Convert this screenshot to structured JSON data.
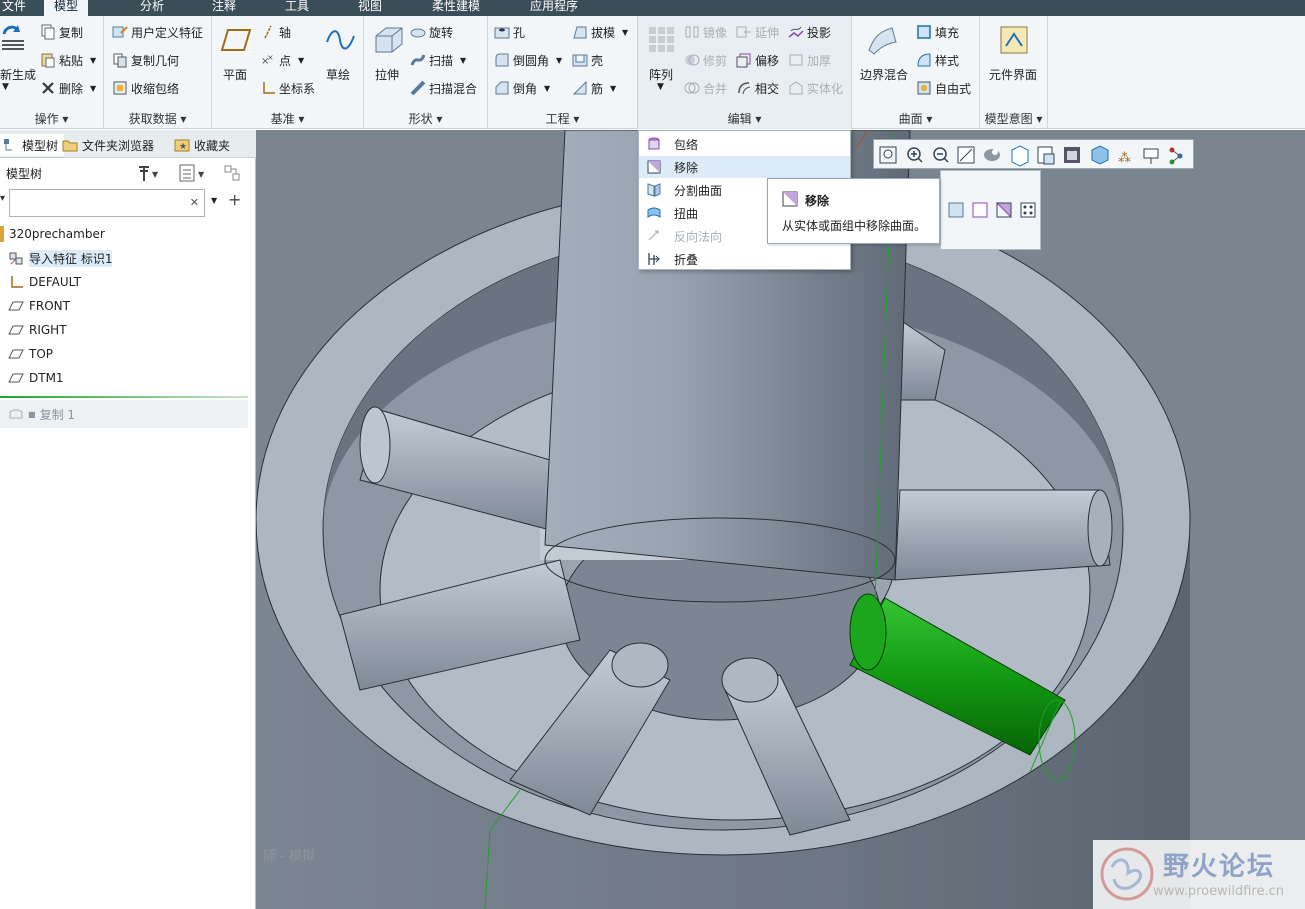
{
  "menu": {
    "tabs": [
      "文件",
      "模型",
      "分析",
      "注释",
      "工具",
      "视图",
      "柔性建模",
      "应用程序"
    ]
  },
  "ribbon": {
    "ops": {
      "regen": "新生成",
      "copy": "复制",
      "paste": "粘贴",
      "delete": "删除",
      "label": "操作"
    },
    "getdata": {
      "udf": "用户定义特征",
      "copygeom": "复制几何",
      "shrinkwrap": "收缩包络",
      "label": "获取数据"
    },
    "datum": {
      "plane": "平面",
      "axis": "轴",
      "point": "点",
      "csys": "坐标系",
      "sketch": "草绘",
      "label": "基准"
    },
    "shapes": {
      "extrude": "拉伸",
      "revolve": "旋转",
      "sweep": "扫描",
      "sweptblend": "扫描混合",
      "label": "形状"
    },
    "eng": {
      "hole": "孔",
      "round": "倒圆角",
      "chamfer": "倒角",
      "draft": "拔模",
      "shell": "壳",
      "rib": "筋",
      "label": "工程"
    },
    "edit": {
      "pattern": "阵列",
      "mirror": "镜像",
      "trim": "修剪",
      "merge": "合并",
      "extend": "延伸",
      "offset": "偏移",
      "intersect": "相交",
      "project": "投影",
      "thicken": "加厚",
      "solidify": "实体化",
      "label": "编辑"
    },
    "surf": {
      "boundary": "边界混合",
      "fill": "填充",
      "style": "样式",
      "freestyle": "自由式",
      "label": "曲面"
    },
    "intent": {
      "component": "元件界面",
      "label": "模型意图"
    }
  },
  "panel": {
    "tabs": [
      "模型树",
      "文件夹浏览器",
      "收藏夹"
    ],
    "title": "模型树",
    "search_value": "",
    "items": [
      "320prechamber",
      "导入特征 标识1",
      "DEFAULT",
      "FRONT",
      "RIGHT",
      "TOP",
      "DTM1"
    ],
    "insert_item": "复制 1"
  },
  "dropdown": {
    "items": [
      "包络",
      "移除",
      "分割曲面",
      "扭曲",
      "反向法向",
      "折叠"
    ],
    "highlighted": "移除"
  },
  "tooltip": {
    "title": "移除",
    "desc": "从实体或面组中移除曲面。"
  },
  "watermark": {
    "text": "野火论坛",
    "url": "www.proewildfire.cn"
  },
  "viewport": {
    "faint_text": "随 - 模拟"
  },
  "colors": {
    "accent": "#1fa22a",
    "selection": "#16a016",
    "menubar": "#3a4e58",
    "ribbon": "#f3f6f9"
  }
}
